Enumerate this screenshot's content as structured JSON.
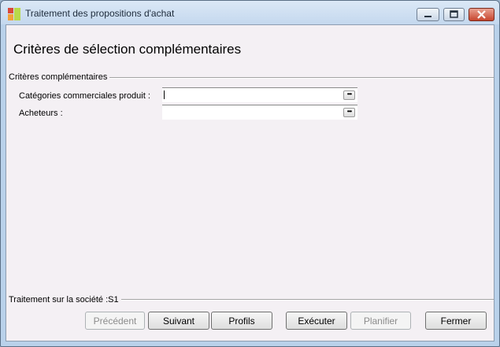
{
  "window": {
    "title": "Traitement des propositions d'achat"
  },
  "page": {
    "heading": "Critères de sélection complémentaires"
  },
  "criteria_group": {
    "label": "Critères complémentaires",
    "fields": [
      {
        "label": "Catégories commerciales produit :",
        "value": ""
      },
      {
        "label": "Acheteurs :",
        "value": ""
      }
    ],
    "picker_glyph": "•••"
  },
  "footer": {
    "company_label": "Traitement sur la société :S1"
  },
  "buttons": {
    "previous": "Précédent",
    "next": "Suivant",
    "profiles": "Profils",
    "execute": "Exécuter",
    "schedule": "Planifier",
    "close": "Fermer"
  },
  "colors": {
    "titlebar": "#c4d8ee",
    "client_background": "#f4f0f4",
    "close_button": "#c7452d"
  }
}
